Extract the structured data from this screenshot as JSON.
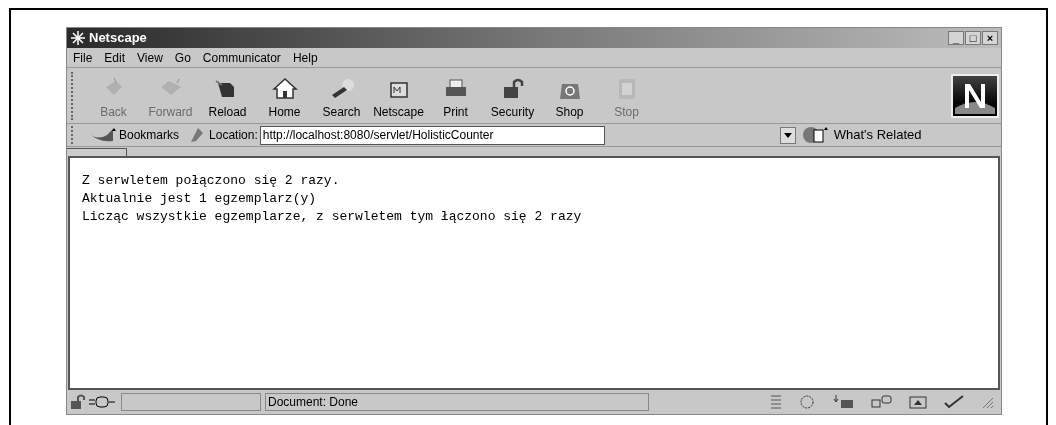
{
  "window": {
    "title": "Netscape",
    "controls": [
      "_",
      "□",
      "×"
    ]
  },
  "menu": [
    "File",
    "Edit",
    "View",
    "Go",
    "Communicator",
    "Help"
  ],
  "toolbar": [
    {
      "label": "Back",
      "disabled": true
    },
    {
      "label": "Forward",
      "disabled": true
    },
    {
      "label": "Reload",
      "disabled": false
    },
    {
      "label": "Home",
      "disabled": false
    },
    {
      "label": "Search",
      "disabled": false
    },
    {
      "label": "Netscape",
      "disabled": false
    },
    {
      "label": "Print",
      "disabled": false
    },
    {
      "label": "Security",
      "disabled": false
    },
    {
      "label": "Shop",
      "disabled": false
    },
    {
      "label": "Stop",
      "disabled": true
    }
  ],
  "location_bar": {
    "bookmarks": "Bookmarks",
    "location_label": "Location:",
    "url": "http://localhost:8080/servlet/HolisticCounter",
    "related": "What's Related"
  },
  "content": [
    "Z serwletem połączono się 2 razy.",
    "Aktualnie jest 1 egzemplarz(y)",
    "Licząc wszystkie egzemplarze, z serwletem tym łączono się 2 razy"
  ],
  "status_bar": {
    "text": "Document: Done"
  }
}
